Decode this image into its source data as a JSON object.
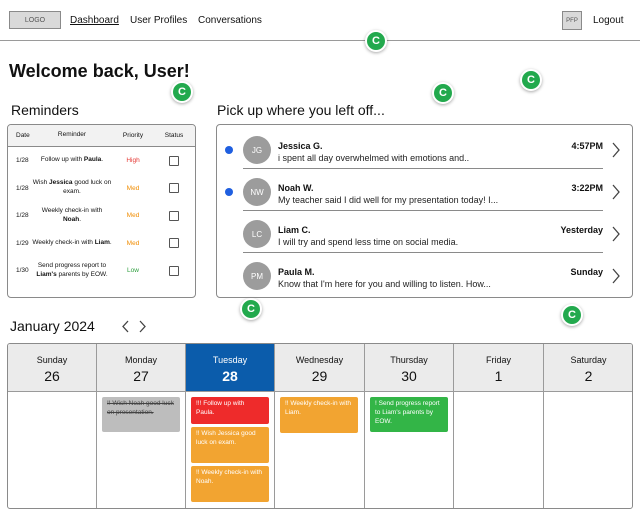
{
  "nav": {
    "logo": "LOGO",
    "links": [
      "Dashboard",
      "User Profiles",
      "Conversations"
    ],
    "pfp": "PFP",
    "logout": "Logout"
  },
  "welcome": "Welcome back, User!",
  "badge_letter": "C",
  "reminders": {
    "title": "Reminders",
    "columns": [
      "Date",
      "Reminder",
      "Priority",
      "Status"
    ],
    "rows": [
      {
        "date": "1/28",
        "pre": "Follow up with ",
        "bold": "Paula",
        "post": ".",
        "priority": "High",
        "priority_color": "#e53935",
        "checked": false
      },
      {
        "date": "1/28",
        "pre": "Wish ",
        "bold": "Jessica",
        "post": " good luck on exam.",
        "priority": "Med",
        "priority_color": "#f08c00",
        "checked": false
      },
      {
        "date": "1/28",
        "pre": "Weekly check-in with ",
        "bold": "Noah",
        "post": ".",
        "priority": "Med",
        "priority_color": "#f08c00",
        "checked": false
      },
      {
        "date": "1/29",
        "pre": "Weekly check-in with ",
        "bold": "Liam",
        "post": ".",
        "priority": "Med",
        "priority_color": "#f08c00",
        "checked": false
      },
      {
        "date": "1/30",
        "pre": "Send progress report to ",
        "bold": "Liam's",
        "post": " parents by EOW.",
        "priority": "Low",
        "priority_color": "#2e9e3e",
        "checked": false
      }
    ]
  },
  "conversations": {
    "title": "Pick up where you left off...",
    "items": [
      {
        "initials": "JG",
        "name": "Jessica G.",
        "message": "i spent all day overwhelmed with emotions and..",
        "time": "4:57PM",
        "unread": true
      },
      {
        "initials": "NW",
        "name": "Noah W.",
        "message": "My teacher said I did well for my presentation today! I...",
        "time": "3:22PM",
        "unread": true
      },
      {
        "initials": "LC",
        "name": "Liam C.",
        "message": "I will try and spend less time on social media.",
        "time": "Yesterday",
        "unread": false
      },
      {
        "initials": "PM",
        "name": "Paula M.",
        "message": "Know that I'm here for you and willing to listen. How...",
        "time": "Sunday",
        "unread": false
      }
    ]
  },
  "calendar": {
    "month": "January 2024",
    "days": [
      {
        "name": "Sunday",
        "num": "26",
        "today": false,
        "events": []
      },
      {
        "name": "Monday",
        "num": "27",
        "today": false,
        "events": [
          {
            "text": "!! Wish Noah good luck on presentation.",
            "style": "gray"
          }
        ]
      },
      {
        "name": "Tuesday",
        "num": "28",
        "today": true,
        "events": [
          {
            "text": "!!! Follow up with Paula.",
            "style": "red"
          },
          {
            "text": "!! Wish Jessica good luck on exam.",
            "style": "orange"
          },
          {
            "text": "!! Weekly check-in with Noah.",
            "style": "orange"
          }
        ]
      },
      {
        "name": "Wednesday",
        "num": "29",
        "today": false,
        "events": [
          {
            "text": "!! Weekly check-in with Liam.",
            "style": "orange"
          }
        ]
      },
      {
        "name": "Thursday",
        "num": "30",
        "today": false,
        "events": [
          {
            "text": "! Send progress report to Liam's parents by EOW.",
            "style": "green"
          }
        ]
      },
      {
        "name": "Friday",
        "num": "1",
        "today": false,
        "events": []
      },
      {
        "name": "Saturday",
        "num": "2",
        "today": false,
        "events": []
      }
    ]
  },
  "colors": {
    "accent": "#0b5cab",
    "badge": "#22a94d",
    "unread": "#1f5fe0"
  },
  "icons": {
    "badge": "c-badge-icon",
    "chevron": "chevron-right-icon",
    "prev": "chevron-left-icon",
    "next": "chevron-right-icon"
  }
}
